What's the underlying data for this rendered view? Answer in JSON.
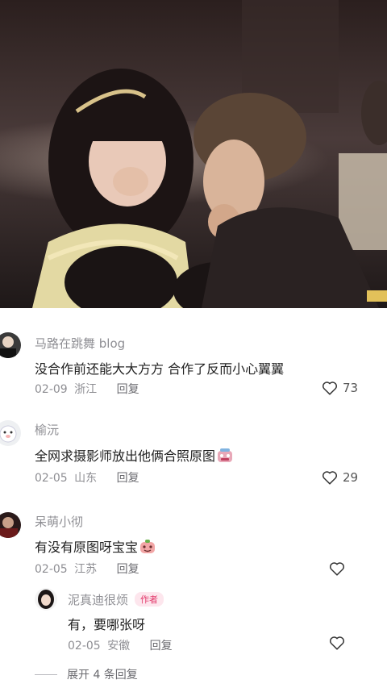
{
  "photo": {
    "description_icon": "photo-image"
  },
  "comments": [
    {
      "username": "马路在跳舞 blog",
      "text": "没合作前还能大大方方 合作了反而小心翼翼",
      "date": "02-09",
      "location": "浙江",
      "reply_label": "回复",
      "likes": "73"
    },
    {
      "username": "榆沅",
      "text": "全网求摄影师放出他俩合照原图",
      "date": "02-05",
      "location": "山东",
      "reply_label": "回复",
      "likes": "29"
    },
    {
      "username": "呆萌小彻",
      "text": "有没有原图呀宝宝",
      "date": "02-05",
      "location": "江苏",
      "reply_label": "回复",
      "likes": ""
    }
  ],
  "reply": {
    "username": "泥真迪很烦",
    "badge": "作者",
    "text": "有，要哪张呀",
    "date": "02-05",
    "location": "安徽",
    "reply_label": "回复"
  },
  "expand_label": "展开 4 条回复",
  "colors": {
    "meta": "#8e8e93",
    "text": "#222222",
    "badge": "#e2396b"
  }
}
